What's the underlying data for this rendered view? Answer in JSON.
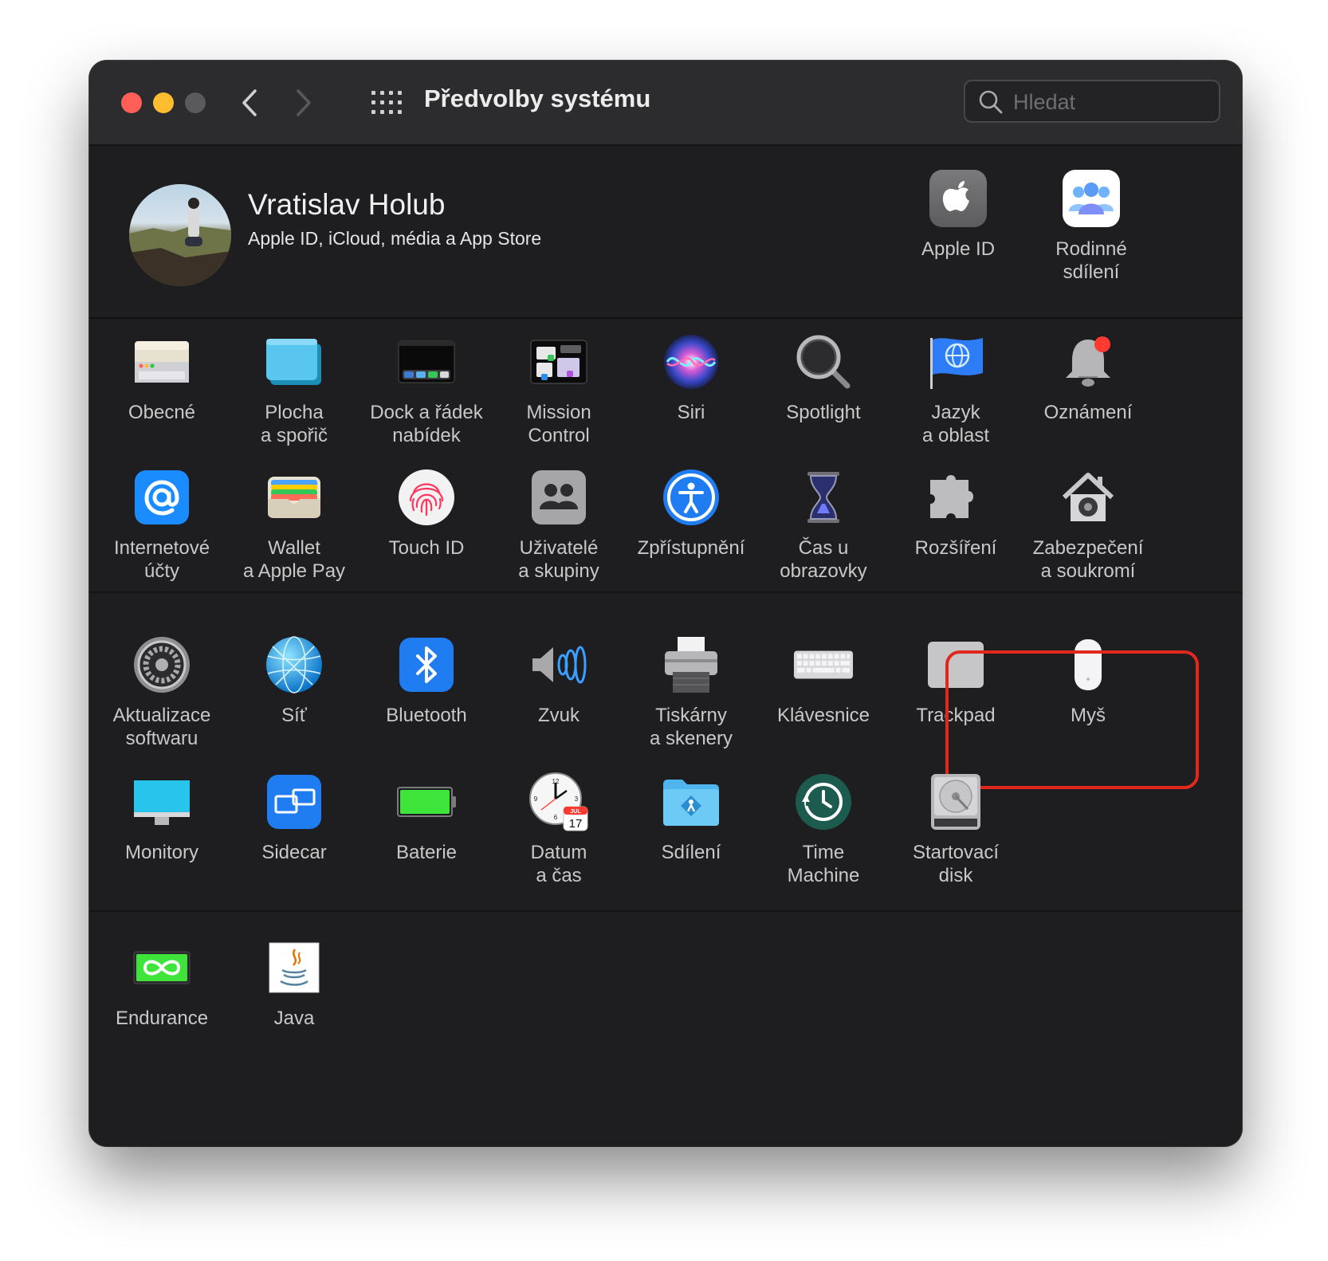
{
  "window": {
    "title": "Předvolby systému",
    "search_placeholder": "Hledat"
  },
  "account": {
    "name": "Vratislav Holub",
    "subtitle": "Apple ID, iCloud, média a App Store",
    "items": [
      {
        "label": "Apple ID",
        "icon": "apple-logo-icon"
      },
      {
        "label": "Rodinné\nsdílení",
        "icon": "family-sharing-icon"
      }
    ]
  },
  "panes": [
    {
      "label": "Obecné",
      "icon": "general-icon"
    },
    {
      "label": "Plocha\na spořič",
      "icon": "desktop-screensaver-icon"
    },
    {
      "label": "Dock a řádek\nnabídek",
      "icon": "dock-menubar-icon"
    },
    {
      "label": "Mission\nControl",
      "icon": "mission-control-icon"
    },
    {
      "label": "Siri",
      "icon": "siri-icon"
    },
    {
      "label": "Spotlight",
      "icon": "spotlight-icon"
    },
    {
      "label": "Jazyk\na oblast",
      "icon": "language-region-icon"
    },
    {
      "label": "Oznámení",
      "icon": "notifications-icon"
    },
    {
      "label": "Internetové\núčty",
      "icon": "internet-accounts-icon"
    },
    {
      "label": "Wallet\na Apple Pay",
      "icon": "wallet-icon"
    },
    {
      "label": "Touch ID",
      "icon": "touch-id-icon"
    },
    {
      "label": "Uživatelé\na skupiny",
      "icon": "users-groups-icon"
    },
    {
      "label": "Zpřístupnění",
      "icon": "accessibility-icon"
    },
    {
      "label": "Čas u obrazovky",
      "icon": "screen-time-icon"
    },
    {
      "label": "Rozšíření",
      "icon": "extensions-icon"
    },
    {
      "label": "Zabezpečení\na soukromí",
      "icon": "security-privacy-icon"
    },
    {
      "label": "Aktualizace\nsoftwaru",
      "icon": "software-update-icon"
    },
    {
      "label": "Síť",
      "icon": "network-icon"
    },
    {
      "label": "Bluetooth",
      "icon": "bluetooth-icon"
    },
    {
      "label": "Zvuk",
      "icon": "sound-icon"
    },
    {
      "label": "Tiskárny\na skenery",
      "icon": "printers-scanners-icon"
    },
    {
      "label": "Klávesnice",
      "icon": "keyboard-icon"
    },
    {
      "label": "Trackpad",
      "icon": "trackpad-icon"
    },
    {
      "label": "Myš",
      "icon": "mouse-icon"
    },
    {
      "label": "Monitory",
      "icon": "displays-icon"
    },
    {
      "label": "Sidecar",
      "icon": "sidecar-icon"
    },
    {
      "label": "Baterie",
      "icon": "battery-icon"
    },
    {
      "label": "Datum\na čas",
      "icon": "date-time-icon"
    },
    {
      "label": "Sdílení",
      "icon": "sharing-icon"
    },
    {
      "label": "Time\nMachine",
      "icon": "time-machine-icon"
    },
    {
      "label": "Startovací\ndisk",
      "icon": "startup-disk-icon"
    },
    {
      "label": "Endurance",
      "icon": "endurance-icon"
    },
    {
      "label": "Java",
      "icon": "java-icon"
    }
  ],
  "icon_text": {
    "calendar_month": "JUL",
    "calendar_day": "17",
    "clock_numbers": [
      "12",
      "3",
      "6",
      "9"
    ]
  },
  "colors": {
    "highlight": "#e0281c",
    "window_bg": "#1e1e20",
    "titlebar_bg": "#2c2c2e"
  }
}
